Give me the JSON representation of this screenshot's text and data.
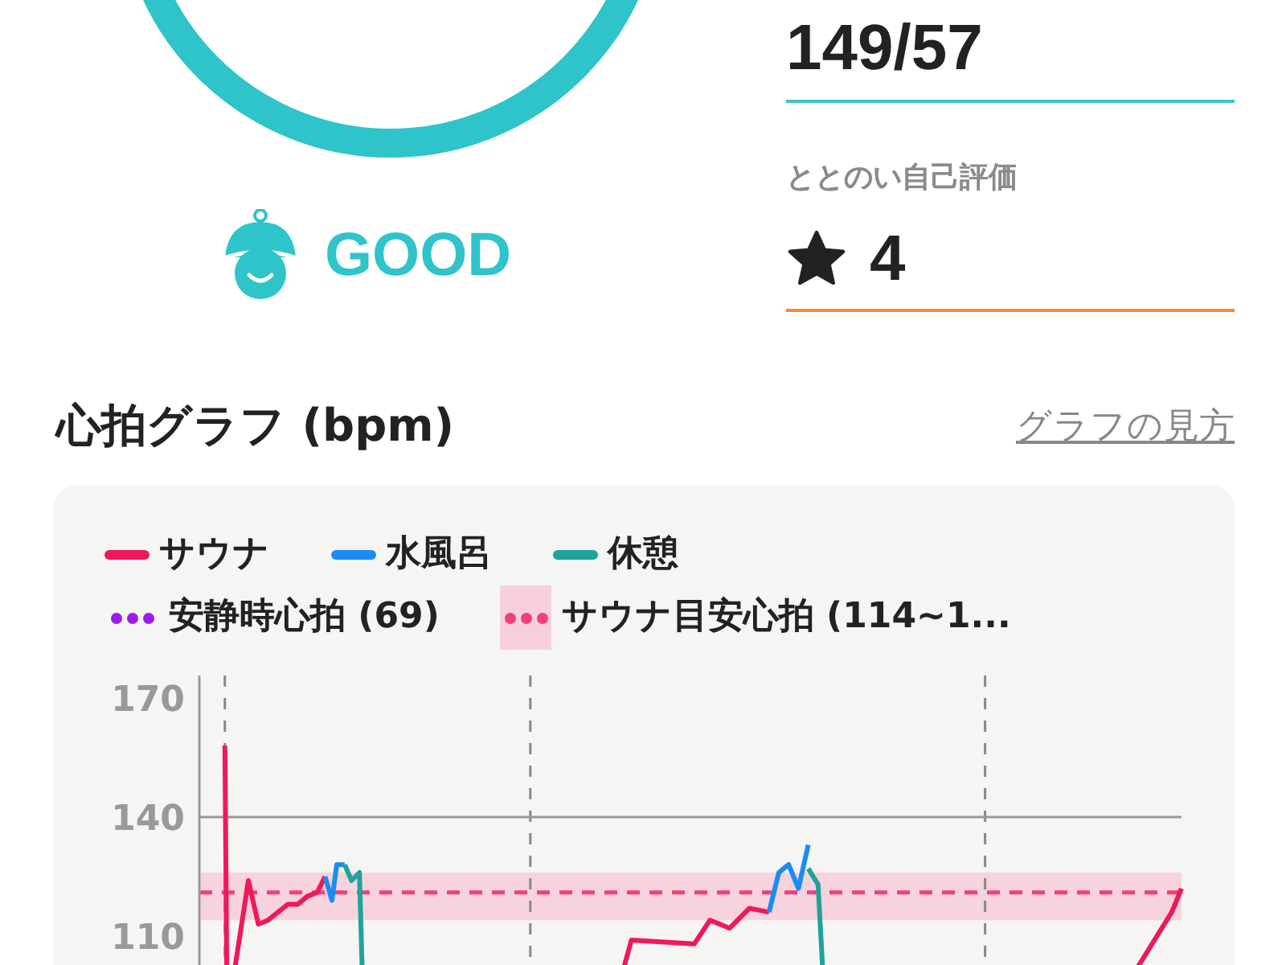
{
  "status": {
    "label": "GOOD"
  },
  "blood_pressure": {
    "value": "149/57"
  },
  "rating": {
    "label": "ととのい自己評価",
    "value": "4"
  },
  "heart_rate": {
    "title": "心拍グラフ (bpm)",
    "help_link": "グラフの見方",
    "legend": [
      {
        "label": "サウナ",
        "kind": "line",
        "color": "#f0185a"
      },
      {
        "label": "水風呂",
        "kind": "line",
        "color": "#1a8cf5"
      },
      {
        "label": "休憩",
        "kind": "line",
        "color": "#1fa39a"
      },
      {
        "label": "安静時心拍 (69)",
        "kind": "dots",
        "color": "#9a1ee8"
      },
      {
        "label": "サウナ目安心拍 (114~1...",
        "kind": "band",
        "color": "#f0407a"
      }
    ],
    "y_axis_labels": [
      "170",
      "140",
      "110"
    ]
  }
}
